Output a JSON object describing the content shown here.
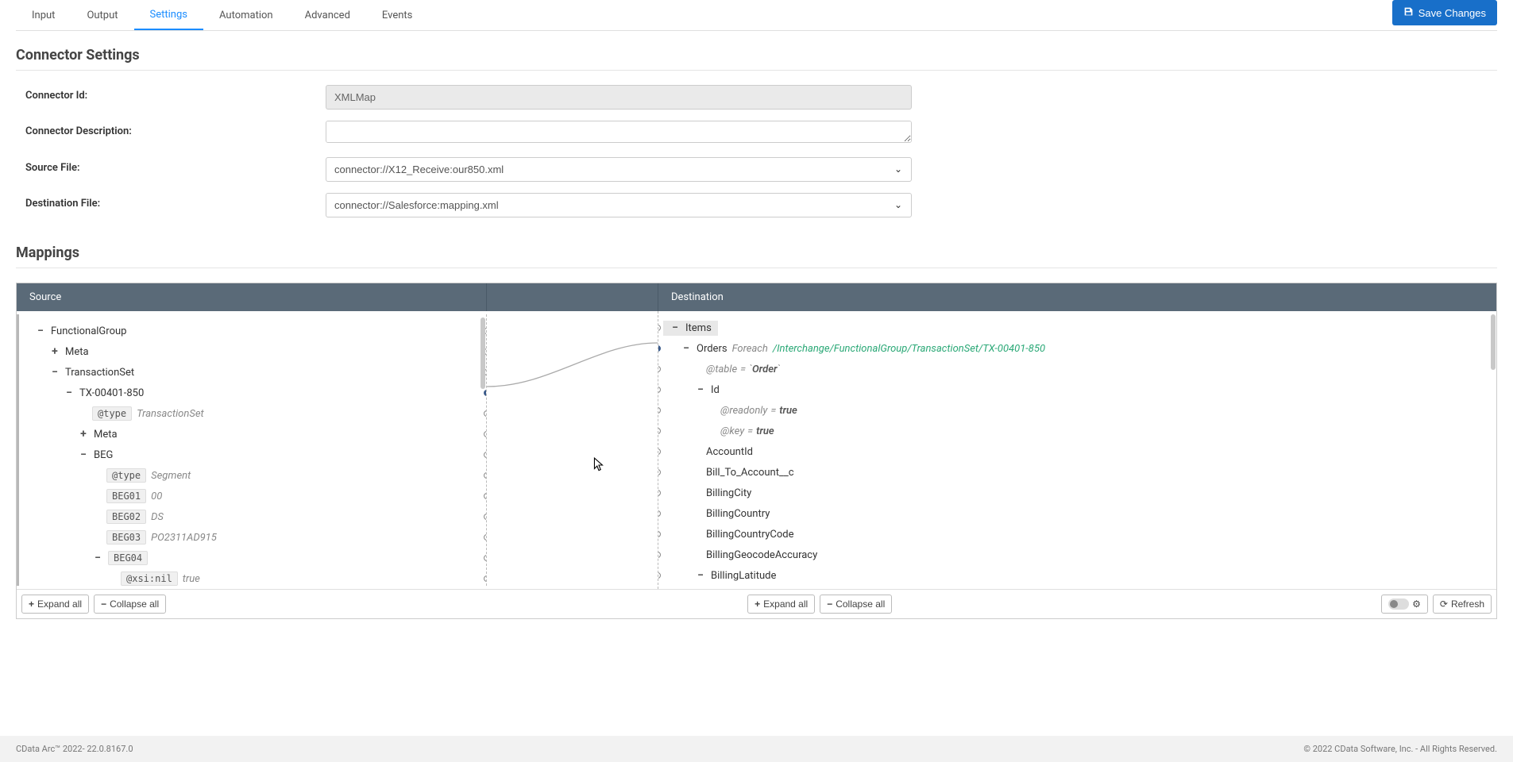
{
  "tabs": [
    "Input",
    "Output",
    "Settings",
    "Automation",
    "Advanced",
    "Events"
  ],
  "active_tab": "Settings",
  "save_button": "Save Changes",
  "section1": {
    "title": "Connector Settings",
    "fields": {
      "connector_id": {
        "label": "Connector Id:",
        "value": "XMLMap"
      },
      "connector_desc": {
        "label": "Connector Description:",
        "value": ""
      },
      "source_file": {
        "label": "Source File:",
        "value": "connector://X12_Receive:our850.xml"
      },
      "dest_file": {
        "label": "Destination File:",
        "value": "connector://Salesforce:mapping.xml"
      }
    }
  },
  "section2": {
    "title": "Mappings"
  },
  "mapping_header": {
    "source": "Source",
    "destination": "Destination"
  },
  "source_tree": {
    "root": "FunctionalGroup",
    "meta": "Meta",
    "tset": "TransactionSet",
    "tx": "TX-00401-850",
    "tx_type_attr": "@type",
    "tx_type_val": "TransactionSet",
    "meta2": "Meta",
    "beg": "BEG",
    "beg_type_attr": "@type",
    "beg_type_val": "Segment",
    "beg01": {
      "k": "BEG01",
      "v": "00"
    },
    "beg02": {
      "k": "BEG02",
      "v": "DS"
    },
    "beg03": {
      "k": "BEG03",
      "v": "PO2311AD915"
    },
    "beg04": {
      "k": "BEG04"
    },
    "xsi_nil": {
      "k": "@xsi:nil",
      "v": "true"
    }
  },
  "dest_tree": {
    "items": "Items",
    "orders": "Orders",
    "foreach": "Foreach",
    "foreach_path": "/Interchange/FunctionalGroup/TransactionSet/TX-00401-850",
    "table_attr": "@table",
    "table_val": "Order",
    "id": "Id",
    "readonly_attr": "@readonly",
    "readonly_val": "true",
    "key_attr": "@key",
    "key_val": "true",
    "fields": [
      "AccountId",
      "Bill_To_Account__c",
      "BillingCity",
      "BillingCountry",
      "BillingCountryCode",
      "BillingGeocodeAccuracy",
      "BillingLatitude"
    ]
  },
  "footer_buttons": {
    "expand": "Expand all",
    "collapse": "Collapse all",
    "refresh": "Refresh"
  },
  "page_footer": {
    "left": "CData Arc™ 2022- 22.0.8167.0",
    "right": "© 2022 CData Software, Inc. - All Rights Reserved."
  }
}
